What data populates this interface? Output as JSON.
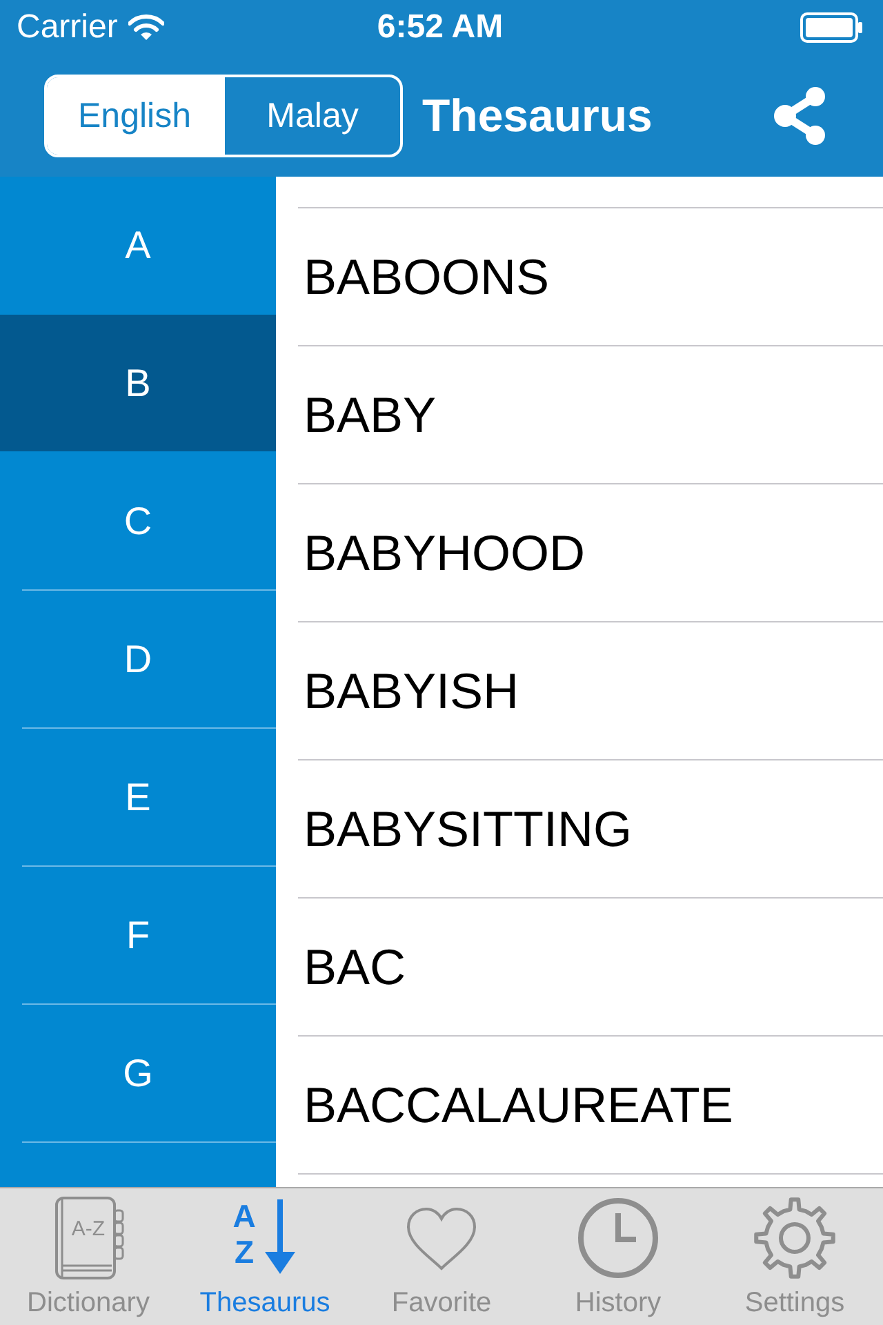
{
  "status_bar": {
    "carrier": "Carrier",
    "time": "6:52 AM"
  },
  "nav_bar": {
    "segments": [
      {
        "label": "English",
        "selected": true
      },
      {
        "label": "Malay",
        "selected": false
      }
    ],
    "title": "Thesaurus"
  },
  "index": [
    {
      "letter": "A",
      "selected": false
    },
    {
      "letter": "B",
      "selected": true
    },
    {
      "letter": "C",
      "selected": false
    },
    {
      "letter": "D",
      "selected": false
    },
    {
      "letter": "E",
      "selected": false
    },
    {
      "letter": "F",
      "selected": false
    },
    {
      "letter": "G",
      "selected": false
    }
  ],
  "words": [
    "BABOONS",
    "BABY",
    "BABYHOOD",
    "BABYISH",
    "BABYSITTING",
    "BAC",
    "BACCALAUREATE"
  ],
  "tab_bar": [
    {
      "kind": "dictionary",
      "label": "Dictionary",
      "icon_text": "A-Z",
      "selected": false
    },
    {
      "kind": "thesaurus",
      "label": "Thesaurus",
      "icon_letters": [
        "A",
        "Z"
      ],
      "selected": true
    },
    {
      "kind": "favorite",
      "label": "Favorite",
      "selected": false
    },
    {
      "kind": "history",
      "label": "History",
      "selected": false
    },
    {
      "kind": "settings",
      "label": "Settings",
      "selected": false
    }
  ]
}
